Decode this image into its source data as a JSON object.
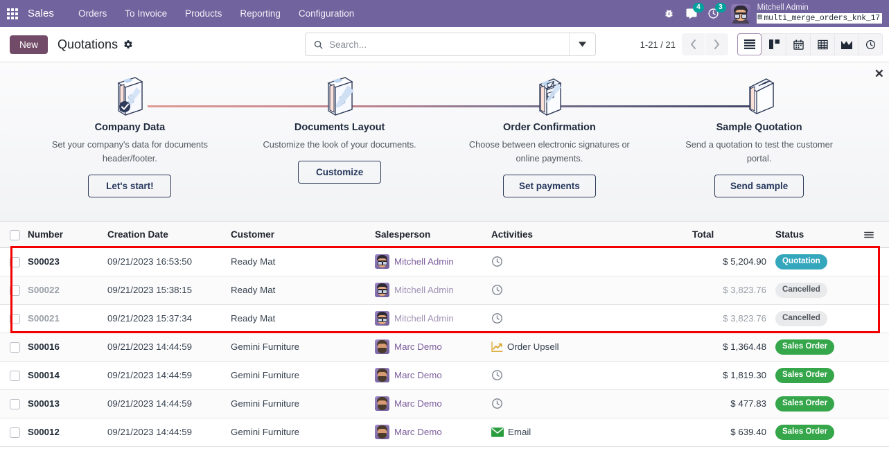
{
  "navbar": {
    "apps_icon": "apps-grid-icon",
    "brand": "Sales",
    "menus": [
      "Orders",
      "To Invoice",
      "Products",
      "Reporting",
      "Configuration"
    ],
    "bug_icon": "bug-icon",
    "messages_icon": "chat-icon",
    "messages_count": "4",
    "activities_icon": "clock-icon",
    "activities_count": "3",
    "avatar": "user-avatar",
    "user_name": "Mitchell Admin",
    "database": "multi_merge_orders_knk_17",
    "database_icon": "database-icon"
  },
  "control_panel": {
    "new_label": "New",
    "title": "Quotations",
    "gear_icon": "gear-icon",
    "search_icon": "search-icon",
    "search_value": "",
    "search_placeholder": "Search...",
    "search_toggle_icon": "chevron-down-icon",
    "pager": "1-21 / 21",
    "prev_icon": "chevron-left-icon",
    "next_icon": "chevron-right-icon",
    "views": [
      {
        "name": "list",
        "icon": "list-view-icon",
        "active": true
      },
      {
        "name": "kanban",
        "icon": "kanban-view-icon",
        "active": false
      },
      {
        "name": "calendar",
        "icon": "calendar-view-icon",
        "active": false
      },
      {
        "name": "pivot",
        "icon": "pivot-view-icon",
        "active": false
      },
      {
        "name": "graph",
        "icon": "graph-view-icon",
        "active": false
      },
      {
        "name": "activity",
        "icon": "activity-view-icon",
        "active": false
      }
    ]
  },
  "onboarding": {
    "close_icon": "close-icon",
    "steps": [
      {
        "icon": "document-dollar-check-icon",
        "title": "Company Data",
        "desc": "Set your company's data for documents header/footer.",
        "button": "Let's start!"
      },
      {
        "icon": "document-dollar-pen-icon",
        "title": "Documents Layout",
        "desc": "Customize the look of your documents.",
        "button": "Customize"
      },
      {
        "icon": "clipboard-signature-icon",
        "title": "Order Confirmation",
        "desc": "Choose between electronic signatures or online payments.",
        "button": "Set payments"
      },
      {
        "icon": "envelope-book-icon",
        "title": "Sample Quotation",
        "desc": "Send a quotation to test the customer portal.",
        "button": "Send sample"
      }
    ]
  },
  "table": {
    "columns": {
      "number": "Number",
      "creation_date": "Creation Date",
      "customer": "Customer",
      "salesperson": "Salesperson",
      "activities": "Activities",
      "total": "Total",
      "status": "Status"
    },
    "options_icon": "column-options-icon",
    "select_all_icon": "checkbox-icon",
    "rows": [
      {
        "number": "S00023",
        "date": "09/21/2023 16:53:50",
        "customer": "Ready Mat",
        "salesperson": "Mitchell Admin",
        "avatar": "mitchell",
        "activity_icon": "clock-icon",
        "activity_label": "",
        "total": "$ 5,204.90",
        "status": "Quotation",
        "status_class": "b-quotation",
        "muted": false,
        "highlighted": true
      },
      {
        "number": "S00022",
        "date": "09/21/2023 15:38:15",
        "customer": "Ready Mat",
        "salesperson": "Mitchell Admin",
        "avatar": "mitchell",
        "activity_icon": "clock-icon",
        "activity_label": "",
        "total": "$ 3,823.76",
        "status": "Cancelled",
        "status_class": "b-cancelled",
        "muted": true,
        "highlighted": true
      },
      {
        "number": "S00021",
        "date": "09/21/2023 15:37:34",
        "customer": "Ready Mat",
        "salesperson": "Mitchell Admin",
        "avatar": "mitchell",
        "activity_icon": "clock-icon",
        "activity_label": "",
        "total": "$ 3,823.76",
        "status": "Cancelled",
        "status_class": "b-cancelled",
        "muted": true,
        "highlighted": true
      },
      {
        "number": "S00016",
        "date": "09/21/2023 14:44:59",
        "customer": "Gemini Furniture",
        "salesperson": "Marc Demo",
        "avatar": "marc",
        "activity_icon": "chart-upsell-icon",
        "activity_label": "Order Upsell",
        "total": "$ 1,364.48",
        "status": "Sales Order",
        "status_class": "b-sales",
        "muted": false,
        "highlighted": false
      },
      {
        "number": "S00014",
        "date": "09/21/2023 14:44:59",
        "customer": "Gemini Furniture",
        "salesperson": "Marc Demo",
        "avatar": "marc",
        "activity_icon": "clock-icon",
        "activity_label": "",
        "total": "$ 1,819.30",
        "status": "Sales Order",
        "status_class": "b-sales",
        "muted": false,
        "highlighted": false
      },
      {
        "number": "S00013",
        "date": "09/21/2023 14:44:59",
        "customer": "Gemini Furniture",
        "salesperson": "Marc Demo",
        "avatar": "marc",
        "activity_icon": "clock-icon",
        "activity_label": "",
        "total": "$ 477.83",
        "status": "Sales Order",
        "status_class": "b-sales",
        "muted": false,
        "highlighted": false
      },
      {
        "number": "S00012",
        "date": "09/21/2023 14:44:59",
        "customer": "Gemini Furniture",
        "salesperson": "Marc Demo",
        "avatar": "marc",
        "activity_icon": "envelope-icon",
        "activity_label": "Email",
        "total": "$ 639.40",
        "status": "Sales Order",
        "status_class": "b-sales",
        "muted": false,
        "highlighted": false
      }
    ]
  },
  "colors": {
    "navbar": "#71639e",
    "primary": "#714b67",
    "quotation_badge": "#35a7bd",
    "cancelled_badge": "#e9eaec",
    "sales_order_badge": "#35a64a",
    "annotation": "#f20000",
    "badge_counter": "#00a09d"
  }
}
